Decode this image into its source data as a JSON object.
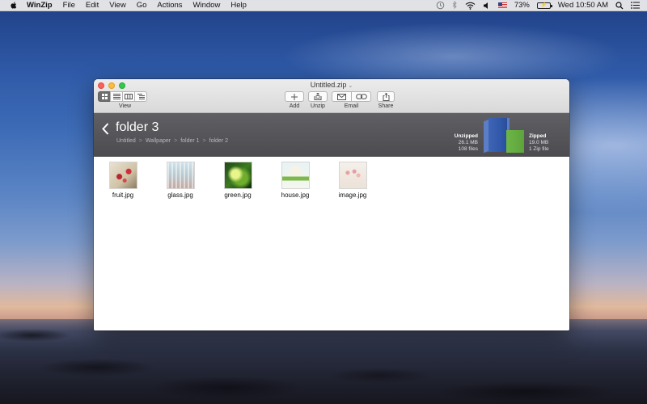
{
  "menubar": {
    "app_name": "WinZip",
    "menus": [
      "File",
      "Edit",
      "View",
      "Go",
      "Actions",
      "Window",
      "Help"
    ],
    "battery": "73%",
    "datetime": "Wed 10:50 AM"
  },
  "window": {
    "title": "Untitled.zip",
    "toolbar": {
      "view_label": "View",
      "add_label": "Add",
      "unzip_label": "Unzip",
      "email_label": "Email",
      "share_label": "Share"
    },
    "pathbar": {
      "folder_name": "folder 3",
      "breadcrumb": [
        "Untitled",
        "Wallpaper",
        "folder 1",
        "folder 2"
      ],
      "separator": ">"
    },
    "size_info": {
      "unzipped_label": "Unzipped",
      "unzipped_size": "26.1 MB",
      "unzipped_count": "108 files",
      "zipped_label": "Zipped",
      "zipped_size": "19.0 MB",
      "zipped_count": "1 Zip file"
    },
    "files": [
      {
        "name": "fruit.jpg"
      },
      {
        "name": "glass.jpg"
      },
      {
        "name": "green.jpg"
      },
      {
        "name": "house.jpg"
      },
      {
        "name": "image.jpg"
      }
    ]
  },
  "colors": {
    "pathbar_bg": "#55555a",
    "unzipped_bar": "#3057a8",
    "zipped_bar": "#5ea43b",
    "close": "#fc605b",
    "minimize": "#fdbc40",
    "zoom": "#34c84a"
  }
}
